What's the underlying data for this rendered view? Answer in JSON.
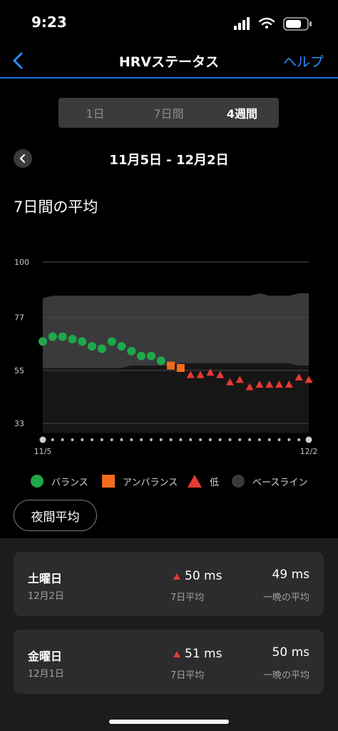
{
  "status": {
    "time": "9:23"
  },
  "nav": {
    "title": "HRVステータス",
    "help": "ヘルプ"
  },
  "segments": [
    {
      "label": "1日",
      "active": false
    },
    {
      "label": "7日間",
      "active": false
    },
    {
      "label": "4週間",
      "active": true
    }
  ],
  "range": {
    "title": "11月5日 - 12月2日"
  },
  "section_title": "7日間の平均",
  "chart_data": {
    "type": "scatter",
    "x_start_label": "11/5",
    "x_end_label": "12/2",
    "y_ticks": [
      100,
      77,
      55,
      33
    ],
    "ylim": [
      28,
      100
    ],
    "days": 28,
    "baseline_upper": [
      85,
      86,
      86,
      86,
      86,
      86,
      86,
      86,
      86,
      86,
      86,
      86,
      86,
      86,
      86,
      86,
      86,
      86,
      86,
      86,
      86,
      86,
      87,
      86,
      86,
      86,
      87,
      87
    ],
    "baseline_lower": [
      56,
      56,
      56,
      56,
      56,
      56,
      56,
      56,
      56,
      57,
      57,
      57,
      57,
      57,
      58,
      58,
      58,
      58,
      58,
      58,
      58,
      58,
      58,
      58,
      58,
      58,
      57,
      57
    ],
    "baseline_floor": 55,
    "points": [
      {
        "day": 0,
        "value": 67,
        "status": "balanced"
      },
      {
        "day": 1,
        "value": 69,
        "status": "balanced"
      },
      {
        "day": 2,
        "value": 69,
        "status": "balanced"
      },
      {
        "day": 3,
        "value": 68,
        "status": "balanced"
      },
      {
        "day": 4,
        "value": 67,
        "status": "balanced"
      },
      {
        "day": 5,
        "value": 65,
        "status": "balanced"
      },
      {
        "day": 6,
        "value": 64,
        "status": "balanced"
      },
      {
        "day": 7,
        "value": 67,
        "status": "balanced"
      },
      {
        "day": 8,
        "value": 65,
        "status": "balanced"
      },
      {
        "day": 9,
        "value": 63,
        "status": "balanced"
      },
      {
        "day": 10,
        "value": 61,
        "status": "balanced"
      },
      {
        "day": 11,
        "value": 61,
        "status": "balanced"
      },
      {
        "day": 12,
        "value": 59,
        "status": "balanced"
      },
      {
        "day": 13,
        "value": 57,
        "status": "unbalanced"
      },
      {
        "day": 14,
        "value": 56,
        "status": "unbalanced"
      },
      {
        "day": 15,
        "value": 53,
        "status": "low"
      },
      {
        "day": 16,
        "value": 53,
        "status": "low"
      },
      {
        "day": 17,
        "value": 54,
        "status": "low"
      },
      {
        "day": 18,
        "value": 53,
        "status": "low"
      },
      {
        "day": 19,
        "value": 50,
        "status": "low"
      },
      {
        "day": 20,
        "value": 51,
        "status": "low"
      },
      {
        "day": 21,
        "value": 48,
        "status": "low"
      },
      {
        "day": 22,
        "value": 49,
        "status": "low"
      },
      {
        "day": 23,
        "value": 49,
        "status": "low"
      },
      {
        "day": 24,
        "value": 49,
        "status": "low"
      },
      {
        "day": 25,
        "value": 49,
        "status": "low"
      },
      {
        "day": 26,
        "value": 52,
        "status": "low"
      },
      {
        "day": 27,
        "value": 51,
        "status": "low"
      }
    ],
    "colors": {
      "balanced": "#1ea84a",
      "unbalanced": "#f26b1d",
      "low": "#e53935",
      "baseline_band": "#3a3a3c",
      "below_band": "#161616"
    }
  },
  "legend": [
    {
      "label": "バランス",
      "icon": "green-circle"
    },
    {
      "label": "アンバランス",
      "icon": "orange-square"
    },
    {
      "label": "低",
      "icon": "red-triangle"
    },
    {
      "label": "ベースライン",
      "icon": "gray-circle"
    }
  ],
  "night_avg_button": "夜間平均",
  "cards": [
    {
      "day": "土曜日",
      "date": "12月2日",
      "seven_day": "50 ms",
      "seven_day_label": "7日平均",
      "night": "49 ms",
      "night_label": "一晩の平均"
    },
    {
      "day": "金曜日",
      "date": "12月1日",
      "seven_day": "51 ms",
      "seven_day_label": "7日平均",
      "night": "50 ms",
      "night_label": "一晩の平均"
    }
  ]
}
